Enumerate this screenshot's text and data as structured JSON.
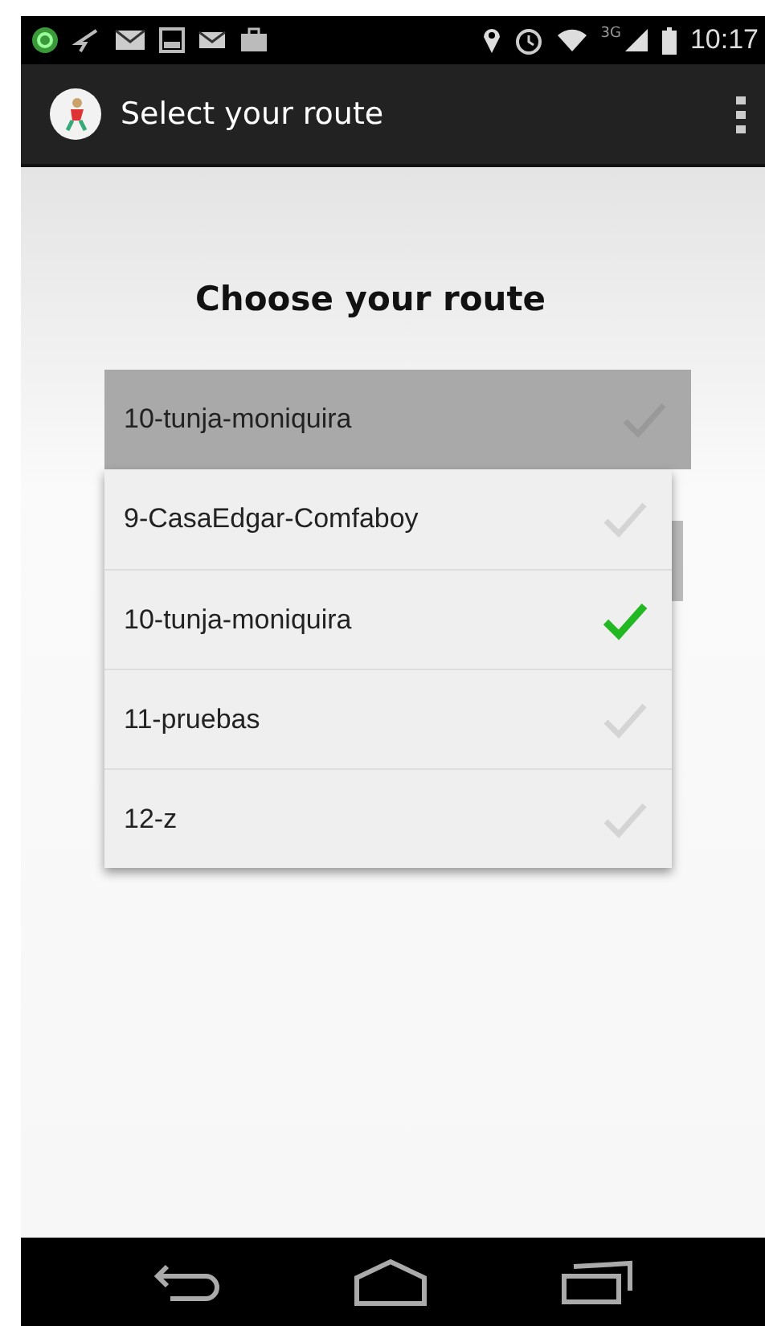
{
  "status_bar": {
    "network": "3G",
    "time": "10:17"
  },
  "app_bar": {
    "title": "Select your route"
  },
  "heading": "Choose your route",
  "spinner": {
    "value": "10-tunja-moniquira",
    "expanded": true
  },
  "options": [
    {
      "label": "9-CasaEdgar-Comfaboy",
      "selected": false
    },
    {
      "label": "10-tunja-moniquira",
      "selected": true
    },
    {
      "label": "11-pruebas",
      "selected": false
    },
    {
      "label": "12-z",
      "selected": false
    }
  ]
}
